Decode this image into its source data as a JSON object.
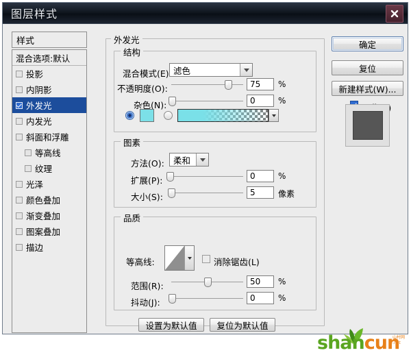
{
  "window": {
    "title": "图层样式",
    "close_icon": "close-icon"
  },
  "styles_panel": {
    "header": "样式",
    "items": [
      {
        "label": "混合选项:默认",
        "checkbox": false,
        "has_checkbox": false,
        "selected": false,
        "indent": false
      },
      {
        "label": "投影",
        "checkbox": false,
        "has_checkbox": true,
        "selected": false,
        "indent": false
      },
      {
        "label": "内阴影",
        "checkbox": false,
        "has_checkbox": true,
        "selected": false,
        "indent": false
      },
      {
        "label": "外发光",
        "checkbox": true,
        "has_checkbox": true,
        "selected": true,
        "indent": false
      },
      {
        "label": "内发光",
        "checkbox": false,
        "has_checkbox": true,
        "selected": false,
        "indent": false
      },
      {
        "label": "斜面和浮雕",
        "checkbox": false,
        "has_checkbox": true,
        "selected": false,
        "indent": false
      },
      {
        "label": "等高线",
        "checkbox": false,
        "has_checkbox": true,
        "selected": false,
        "indent": true
      },
      {
        "label": "纹理",
        "checkbox": false,
        "has_checkbox": true,
        "selected": false,
        "indent": true
      },
      {
        "label": "光泽",
        "checkbox": false,
        "has_checkbox": true,
        "selected": false,
        "indent": false
      },
      {
        "label": "颜色叠加",
        "checkbox": false,
        "has_checkbox": true,
        "selected": false,
        "indent": false
      },
      {
        "label": "渐变叠加",
        "checkbox": false,
        "has_checkbox": true,
        "selected": false,
        "indent": false
      },
      {
        "label": "图案叠加",
        "checkbox": false,
        "has_checkbox": true,
        "selected": false,
        "indent": false
      },
      {
        "label": "描边",
        "checkbox": false,
        "has_checkbox": true,
        "selected": false,
        "indent": false
      }
    ]
  },
  "main": {
    "group_title": "外发光",
    "structure": {
      "title": "结构",
      "blend_mode": {
        "label": "混合模式(E):",
        "value": "滤色"
      },
      "opacity": {
        "label": "不透明度(O):",
        "value": "75",
        "unit": "%",
        "slider_pct": 75
      },
      "noise": {
        "label": "杂色(N):",
        "value": "0",
        "unit": "%",
        "slider_pct": 0
      },
      "fill_mode": {
        "color_radio_selected": true,
        "color_value": "#7ce0e8",
        "gradient_radio_selected": false,
        "gradient_from": "#7ce0e8",
        "gradient_to": "transparent"
      }
    },
    "elements": {
      "title": "图素",
      "technique": {
        "label": "方法(O):",
        "value": "柔和"
      },
      "spread": {
        "label": "扩展(P):",
        "value": "0",
        "unit": "%",
        "slider_pct": 0
      },
      "size": {
        "label": "大小(S):",
        "value": "5",
        "unit": "像素",
        "slider_pct": 2
      }
    },
    "quality": {
      "title": "品质",
      "contour": {
        "label": "等高线:",
        "icon": "contour-linear-icon"
      },
      "anti_alias": {
        "label": "消除锯齿(L)",
        "checked": false
      },
      "range": {
        "label": "范围(R):",
        "value": "50",
        "unit": "%",
        "slider_pct": 50
      },
      "jitter": {
        "label": "抖动(J):",
        "value": "0",
        "unit": "%",
        "slider_pct": 0
      }
    },
    "footer_buttons": {
      "set_default": "设置为默认值",
      "reset_default": "复位为默认值"
    }
  },
  "right_panel": {
    "ok": "确定",
    "reset": "复位",
    "new_style": "新建样式(W)...",
    "preview": {
      "label": "预览(V)",
      "checked": true
    },
    "preview_swatch_color": "#565656"
  },
  "watermark": {
    "part1": "shan",
    "part2": "cun",
    "sub1": "山村网",
    "sub2": ".net",
    "color1": "#5aa520",
    "color2": "#e8811a"
  }
}
